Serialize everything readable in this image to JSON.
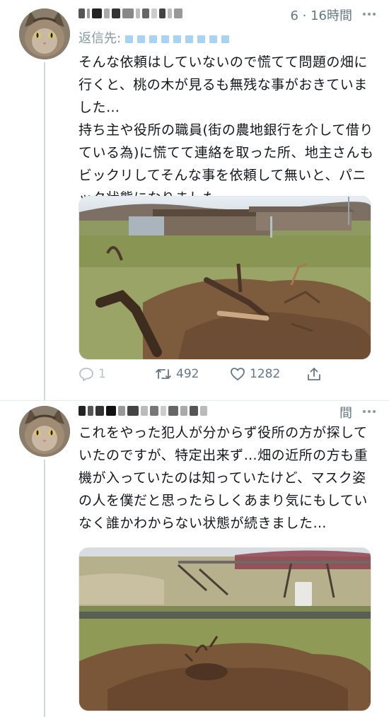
{
  "tweets": [
    {
      "time": "6 · 16時間",
      "reply_to_label": "返信先:",
      "paragraphs": [
        "そんな依頼はしていないので慌てて問題の畑に行くと、桃の木が見るも無残な事がおきていました…",
        "持ち主や役所の職員(街の農地銀行を介して借りている為)に慌てて連絡を取った所、地主さんもビックリしてそんな事を依頼して無いと、パニック状態になりました。"
      ],
      "actions": {
        "replies": "1",
        "retweets": "492",
        "likes": "1282"
      }
    },
    {
      "time": "間",
      "paragraphs": [
        "これをやった犯人が分からず役所の方が探していたのですが、特定出来ず…畑の近所の方も重機が入っていたのは知っていたけど、マスク姿の人を僕だと思ったらしくあまり気にもしていなく誰かわからない状態が続きました…"
      ]
    }
  ],
  "icons": [
    "more-icon",
    "reply-icon",
    "retweet-icon",
    "like-icon",
    "share-icon"
  ],
  "colors": {
    "thread_line": "#cfd9de",
    "meta_text": "#657786",
    "reply_link": "#a9d3f2"
  }
}
